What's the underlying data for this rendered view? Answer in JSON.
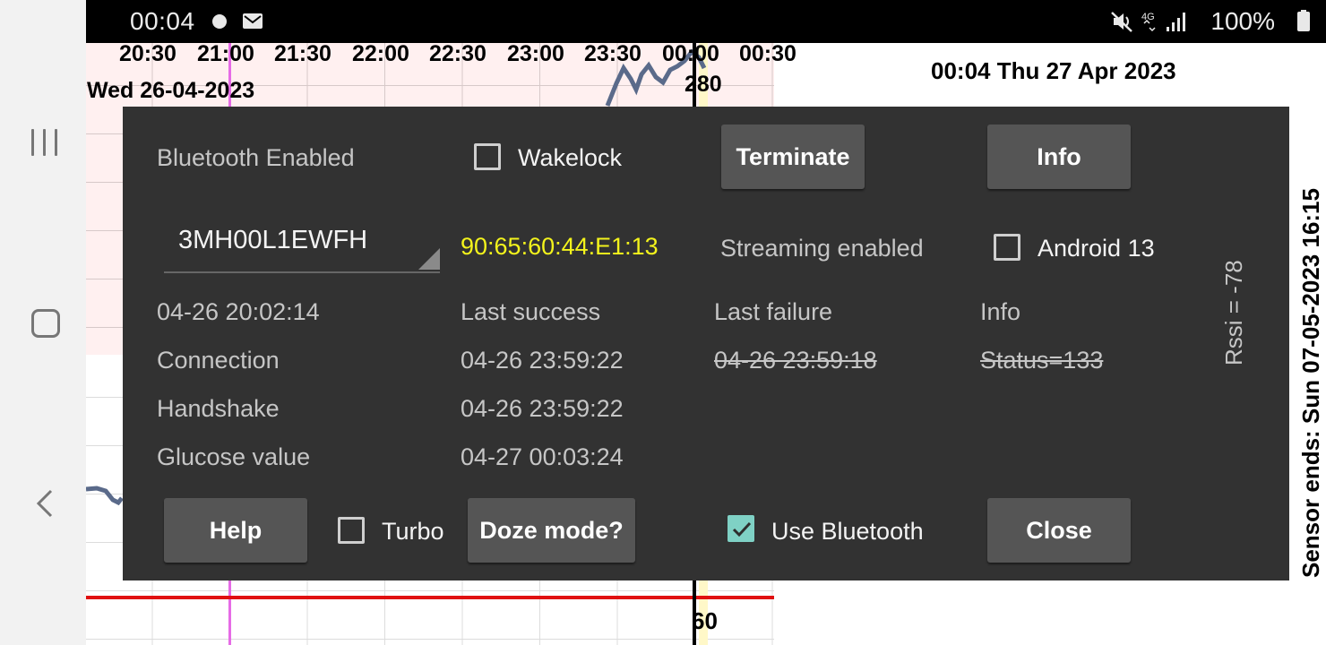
{
  "status_bar": {
    "time": "00:04",
    "battery": "100%",
    "icons": [
      "dot-icon",
      "mail-icon",
      "mute-icon",
      "4g-icon",
      "signal-icon",
      "battery-icon"
    ]
  },
  "graph": {
    "time_ticks": [
      "20:30",
      "21:00",
      "21:30",
      "22:00",
      "22:30",
      "23:00",
      "23:30",
      "00:00",
      "00:30"
    ],
    "date": "Wed 26-04-2023",
    "label_280": "280",
    "label_60": "60"
  },
  "header": {
    "clock": "00:04 Thu 27 Apr 2023",
    "sensor_ends": "Sensor ends: Sun 07-05-2023 16:15"
  },
  "dialog": {
    "bluetooth_status": "Bluetooth Enabled",
    "wakelock_label": "Wakelock",
    "wakelock_checked": false,
    "terminate_label": "Terminate",
    "info_button_label": "Info",
    "sensor_select": "3MH00L1EWFH",
    "mac_address": "90:65:60:44:E1:13",
    "streaming": "Streaming enabled",
    "android13_label": "Android 13",
    "android13_checked": false,
    "rssi": "Rssi = -78",
    "start_time": "04-26 20:02:14",
    "col_last_success": "Last success",
    "col_last_failure": "Last failure",
    "col_info": "Info",
    "rows": [
      {
        "label": "Connection",
        "success": "04-26 23:59:22",
        "failure": "04-26 23:59:18",
        "info": "Status=133"
      },
      {
        "label": "Handshake",
        "success": "04-26 23:59:22",
        "failure": "",
        "info": ""
      },
      {
        "label": "Glucose value",
        "success": "04-27 00:03:24",
        "failure": "",
        "info": ""
      }
    ],
    "help_label": "Help",
    "turbo_label": "Turbo",
    "turbo_checked": false,
    "doze_label": "Doze mode?",
    "use_bluetooth_label": "Use Bluetooth",
    "use_bluetooth_checked": true,
    "close_label": "Close",
    "accent_color": "#7fd1c5",
    "mac_color": "#f3f31c"
  }
}
